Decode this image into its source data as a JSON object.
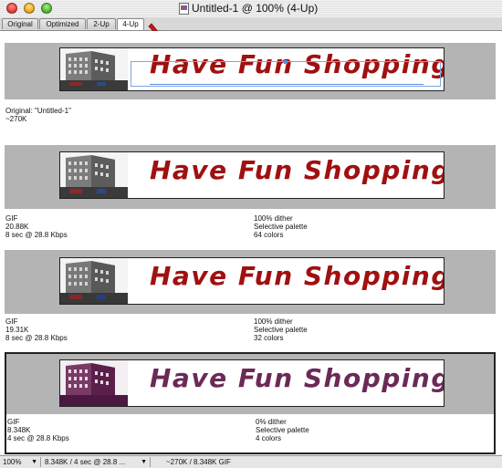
{
  "window": {
    "title": "Untitled-1 @ 100% (4-Up)"
  },
  "tabs": [
    {
      "label": "Original"
    },
    {
      "label": "Optimized"
    },
    {
      "label": "2-Up"
    },
    {
      "label": "4-Up",
      "active": true
    }
  ],
  "banner_text": "Have Fun Shopping",
  "panes": [
    {
      "line1": "Original: \"Untitled-1\"",
      "line2": "~270K"
    },
    {
      "format": "GIF",
      "size": "20.88K",
      "time": "8 sec @ 28.8 Kbps",
      "dither": "100% dither",
      "palette": "Selective palette",
      "colors": "64 colors"
    },
    {
      "format": "GIF",
      "size": "19.31K",
      "time": "8 sec @ 28.8 Kbps",
      "dither": "100% dither",
      "palette": "Selective palette",
      "colors": "32 colors"
    },
    {
      "format": "GIF",
      "size": "8.348K",
      "time": "4 sec @ 28.8 Kbps",
      "dither": "0% dither",
      "palette": "Selective palette",
      "colors": "4 colors"
    }
  ],
  "status": {
    "zoom": "100%",
    "download": "8.348K / 4 sec @ 28.8 ...",
    "sizes": "~270K / 8.348K GIF"
  },
  "colors": {
    "banner_text": "#a01010",
    "banner_text_4color": "#6b2a56",
    "arrow": "#c01818"
  }
}
